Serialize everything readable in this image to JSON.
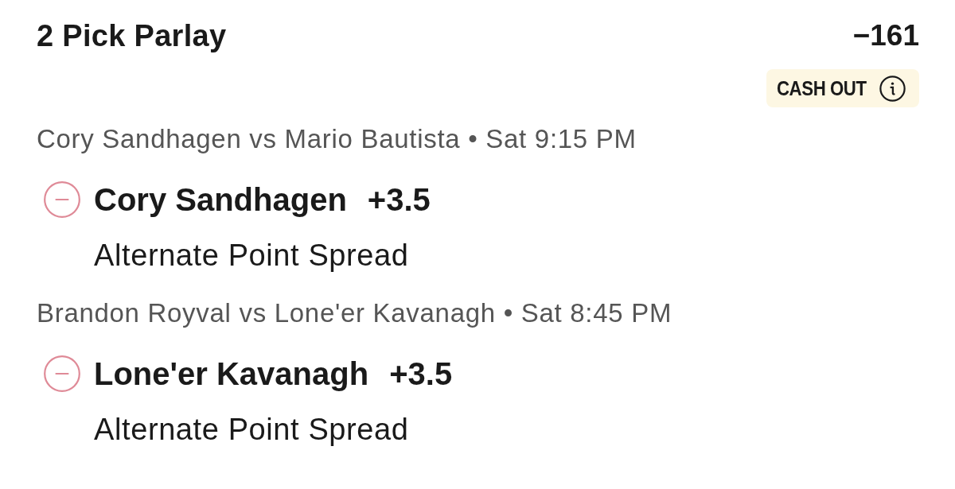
{
  "header": {
    "title": "2 Pick Parlay",
    "odds": "−161",
    "cash_out": {
      "label": "CASH OUT"
    }
  },
  "legs": [
    {
      "event": "Cory Sandhagen vs Mario Bautista",
      "separator": "•",
      "time": "Sat 9:15 PM",
      "pick": "Cory Sandhagen",
      "line": "+3.5",
      "market": "Alternate Point Spread"
    },
    {
      "event": "Brandon Royval vs Lone'er Kavanagh",
      "separator": "•",
      "time": "Sat 8:45 PM",
      "pick": "Lone'er Kavanagh",
      "line": "+3.5",
      "market": "Alternate Point Spread"
    }
  ]
}
